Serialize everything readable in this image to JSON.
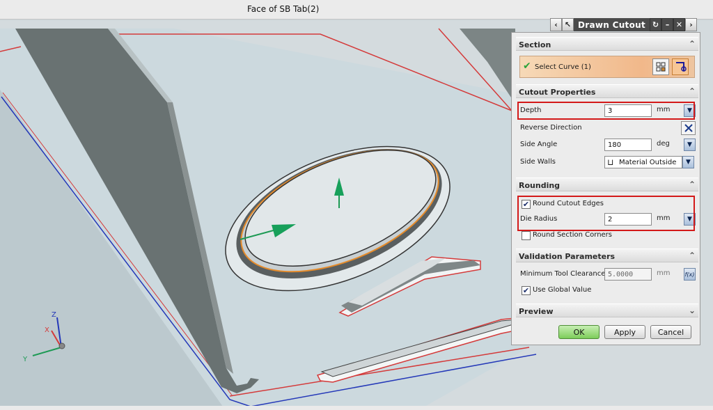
{
  "window": {
    "title": "Face of SB Tab(2)"
  },
  "dialog": {
    "title": "Drawn Cutout",
    "sections": {
      "section": {
        "label": "Section",
        "select_curve": "Select Curve (1)"
      },
      "cutout_properties": {
        "label": "Cutout Properties",
        "depth": {
          "label": "Depth",
          "value": "3",
          "unit": "mm"
        },
        "reverse_direction": {
          "label": "Reverse Direction"
        },
        "side_angle": {
          "label": "Side Angle",
          "value": "180",
          "unit": "deg"
        },
        "side_walls": {
          "label": "Side Walls",
          "value": "Material Outside"
        }
      },
      "rounding": {
        "label": "Rounding",
        "round_cutout_edges": {
          "label": "Round Cutout Edges",
          "checked": true
        },
        "die_radius": {
          "label": "Die Radius",
          "value": "2",
          "unit": "mm"
        },
        "round_section_corners": {
          "label": "Round Section Corners",
          "checked": false
        }
      },
      "validation": {
        "label": "Validation Parameters",
        "min_tool_clearance": {
          "label": "Minimum Tool Clearance",
          "value": "5.0000",
          "unit": "mm"
        },
        "use_global_value": {
          "label": "Use Global Value",
          "checked": true
        }
      },
      "preview": {
        "label": "Preview"
      }
    },
    "buttons": {
      "ok": "OK",
      "apply": "Apply",
      "cancel": "Cancel"
    }
  },
  "triad": {
    "x": "X",
    "y": "Y",
    "z": "Z"
  },
  "colors": {
    "highlight_red": "#d31919",
    "ok_green": "#7dcd5a",
    "selection_orange": "#f1b88a",
    "model_edge_red": "#d43a3a",
    "model_edge_blue": "#2438b8",
    "wall_gray": "#6d7474"
  }
}
